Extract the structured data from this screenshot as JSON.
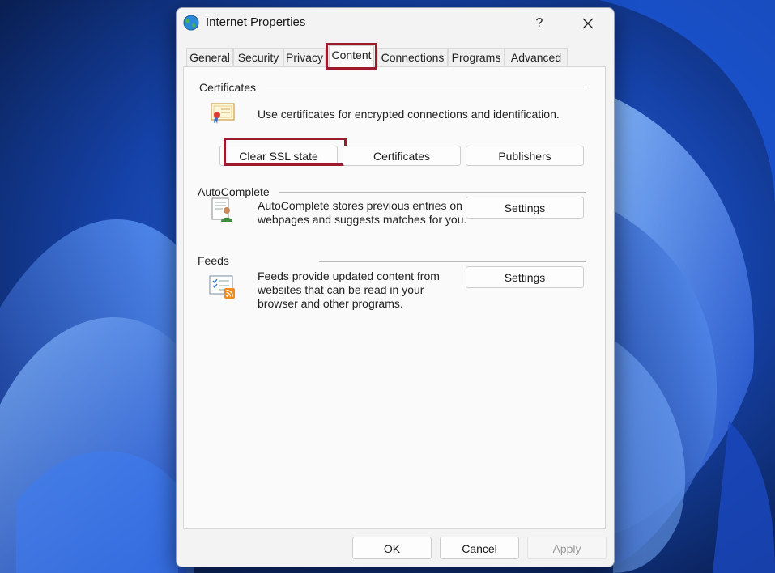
{
  "window": {
    "title": "Internet Properties",
    "help_label": "?",
    "icons": {
      "app": "globe-icon",
      "close": "close-icon"
    }
  },
  "tabs": [
    {
      "label": "General"
    },
    {
      "label": "Security"
    },
    {
      "label": "Privacy"
    },
    {
      "label": "Content",
      "active": true
    },
    {
      "label": "Connections"
    },
    {
      "label": "Programs"
    },
    {
      "label": "Advanced"
    }
  ],
  "certificates": {
    "heading": "Certificates",
    "description": "Use certificates for encrypted connections and identification.",
    "icon": "certificate-icon",
    "buttons": {
      "clear_ssl": "Clear SSL state",
      "certificates": "Certificates",
      "publishers": "Publishers"
    }
  },
  "autocomplete": {
    "heading": "AutoComplete",
    "description": "AutoComplete stores previous entries on webpages and suggests matches for you.",
    "icon": "autocomplete-user-icon",
    "settings_label": "Settings"
  },
  "feeds": {
    "heading": "Feeds",
    "description": "Feeds provide updated content from websites that can be read in your browser and other programs.",
    "icon": "feeds-rss-icon",
    "settings_label": "Settings"
  },
  "footer": {
    "ok": "OK",
    "cancel": "Cancel",
    "apply": "Apply",
    "apply_enabled": false
  },
  "colors": {
    "highlight": "#9b1b2e",
    "dialog_bg": "#f3f3f3",
    "panel_bg": "#fafafa",
    "wallpaper_blue": "#2b66e0"
  }
}
